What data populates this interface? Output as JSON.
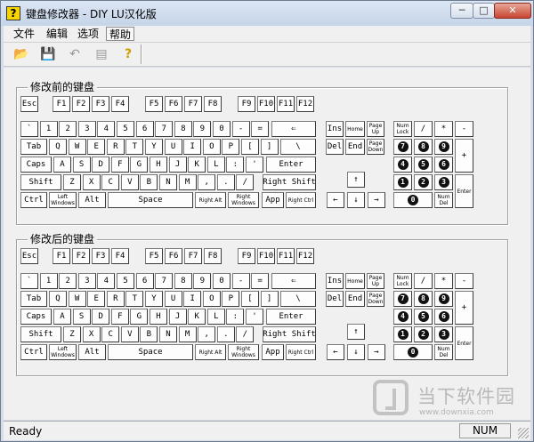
{
  "window": {
    "title": "键盘修改器 - DIY   LU汉化版",
    "app_icon_glyph": "?",
    "minimize_label": "─",
    "maximize_label": "□",
    "close_label": "✕"
  },
  "menu": [
    "文件",
    "编辑",
    "选项",
    "帮助"
  ],
  "menu_active_index": 3,
  "toolbar": [
    {
      "name": "open-icon",
      "glyph": "📂"
    },
    {
      "name": "save-icon",
      "glyph": "💾"
    },
    {
      "name": "undo-icon",
      "glyph": "↶"
    },
    {
      "name": "print-icon",
      "glyph": "▤"
    },
    {
      "name": "help-icon",
      "glyph": "?"
    }
  ],
  "groups": [
    {
      "title": "修改前的键盘"
    },
    {
      "title": "修改后的键盘"
    }
  ],
  "keys": {
    "esc": "Esc",
    "f": [
      "F1",
      "F2",
      "F3",
      "F4",
      "F5",
      "F6",
      "F7",
      "F8",
      "F9",
      "F10",
      "F11",
      "F12"
    ],
    "row1": [
      "`",
      "1",
      "2",
      "3",
      "4",
      "5",
      "6",
      "7",
      "8",
      "9",
      "0",
      "-",
      "=",
      "⇐"
    ],
    "tab": "Tab",
    "row2": [
      "Q",
      "W",
      "E",
      "R",
      "T",
      "Y",
      "U",
      "I",
      "O",
      "P",
      "[",
      "]",
      "\\"
    ],
    "caps": "Caps",
    "row3": [
      "A",
      "S",
      "D",
      "F",
      "G",
      "H",
      "J",
      "K",
      "L",
      ":",
      "'"
    ],
    "enter": "Enter",
    "shift": "Shift",
    "row4": [
      "Z",
      "X",
      "C",
      "V",
      "B",
      "N",
      "M",
      ",",
      ".",
      "/"
    ],
    "rshift": "Right Shift",
    "ctrl": "Ctrl",
    "lwin": "Left Windows",
    "alt": "Alt",
    "space": "Space",
    "ralt": "Right Alt",
    "rwin": "Right Windows",
    "app": "App",
    "rctrl": "Right Ctrl",
    "ins": "Ins",
    "home": "Home",
    "pgup": "Page Up",
    "del": "Del",
    "end": "End",
    "pgdn": "Page Down",
    "up": "↑",
    "left": "←",
    "down": "↓",
    "right": "→",
    "numlock": "Num Lock",
    "nslash": "/",
    "nstar": "*",
    "nminus": "-",
    "nplus": "+",
    "nenter": "Enter",
    "numdel": "Num Del",
    "n7": "7",
    "n8": "8",
    "n9": "9",
    "n4": "4",
    "n5": "5",
    "n6": "6",
    "n1": "1",
    "n2": "2",
    "n3": "3",
    "n0": "0"
  },
  "status": {
    "ready": "Ready",
    "num": "NUM"
  },
  "watermark": {
    "text": "当下软件园",
    "url": "www.downxia.com"
  }
}
